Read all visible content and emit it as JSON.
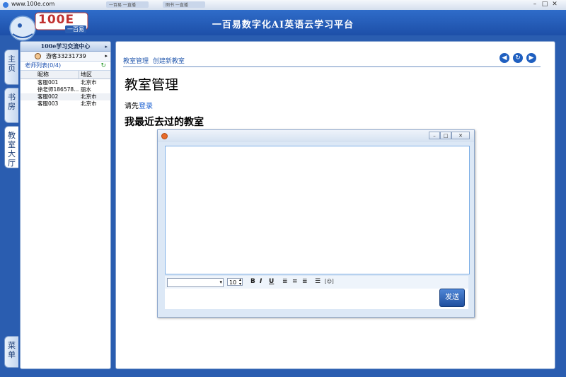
{
  "window": {
    "url": "www.100e.com",
    "tabs": [
      "一百易 一直播",
      "图书 一直播"
    ]
  },
  "header": {
    "logo_text": "100E",
    "logo_sub": "一百易",
    "title": "一百易数字化AI英语云学习平台"
  },
  "left_tabs": [
    {
      "label": "主页",
      "active": false
    },
    {
      "label": "书房",
      "active": false
    },
    {
      "label": "教室大厅",
      "active": true
    },
    {
      "label": "菜单",
      "active": false
    }
  ],
  "sidebar": {
    "title": "100e学习交流中心",
    "user": "游客33231739",
    "teacher_list_label": "老师列表",
    "teacher_count": "(0/4)",
    "columns": [
      "昵称",
      "地区"
    ],
    "rows": [
      {
        "name": "客服001",
        "region": "北京市"
      },
      {
        "name": "徐老师186578...",
        "region": "丽水"
      },
      {
        "name": "客服002",
        "region": "北京市"
      },
      {
        "name": "客服003",
        "region": "北京市"
      }
    ]
  },
  "main": {
    "breadcrumb": [
      "教室管理",
      "创建新教室"
    ],
    "page_title": "教室管理",
    "login_prefix": "请先",
    "login_link": "登录",
    "recent_title": "我最近去过的教室"
  },
  "chat_dialog": {
    "font_size": "10",
    "toolbar": {
      "bold": "B",
      "italic": "I",
      "underline": "U"
    },
    "send_label": "发送"
  },
  "colors": {
    "frame_blue": "#2a5db0",
    "link_blue": "#1a5fd1",
    "send_button": "#1f4f9f"
  }
}
